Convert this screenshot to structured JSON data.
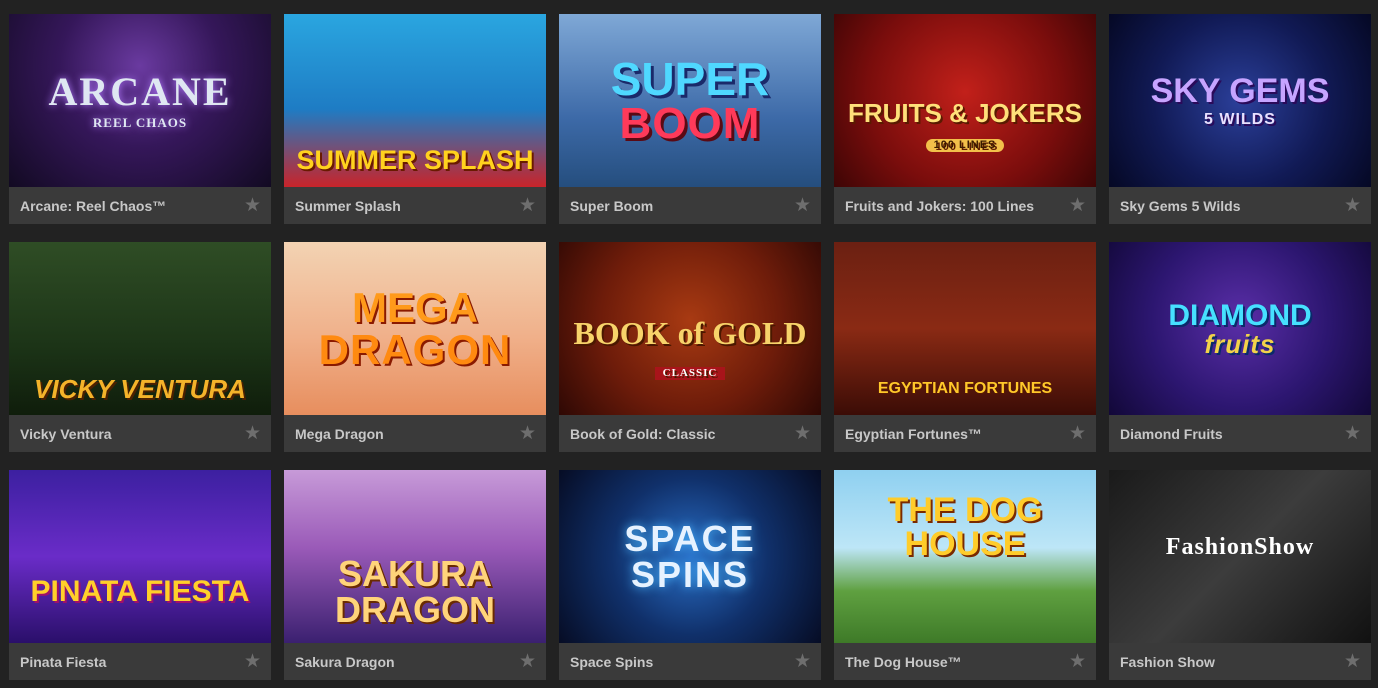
{
  "games": [
    {
      "title": "Arcane: Reel Chaos™",
      "logo": "ARCANE",
      "logo_sub": "REEL CHAOS",
      "art": "a-arcane",
      "logo_class": "l-arcane"
    },
    {
      "title": "Summer Splash",
      "logo": "SUMMER SPLASH",
      "logo_sub": "",
      "art": "a-summer",
      "logo_class": "l-summer"
    },
    {
      "title": "Super Boom",
      "logo": "SUPER",
      "logo_sub": "BOOM",
      "art": "a-super",
      "logo_class": "l-super"
    },
    {
      "title": "Fruits and Jokers: 100 Lines",
      "logo": "FRUITS & JOKERS",
      "logo_sub": "100 LINES",
      "art": "a-fruits",
      "logo_class": "l-fruits"
    },
    {
      "title": "Sky Gems 5 Wilds",
      "logo": "SKY GEMS",
      "logo_sub": "5 WILDS",
      "art": "a-sky",
      "logo_class": "l-sky"
    },
    {
      "title": "Vicky Ventura",
      "logo": "VICKY VENTURA",
      "logo_sub": "",
      "art": "a-vicky",
      "logo_class": "l-vicky"
    },
    {
      "title": "Mega Dragon",
      "logo": "MEGA",
      "logo_sub": "DRAGON",
      "art": "a-mega",
      "logo_class": "l-mega"
    },
    {
      "title": "Book of Gold: Classic",
      "logo": "BOOK of GOLD",
      "logo_sub": "CLASSIC",
      "art": "a-book",
      "logo_class": "l-book"
    },
    {
      "title": "Egyptian Fortunes™",
      "logo": "EGYPTIAN FORTUNES",
      "logo_sub": "",
      "art": "a-egypt",
      "logo_class": "l-egypt"
    },
    {
      "title": "Diamond Fruits",
      "logo": "DIAMOND",
      "logo_sub": "fruits",
      "art": "a-diamond",
      "logo_class": "l-diamond"
    },
    {
      "title": "Pinata Fiesta",
      "logo": "PINATA FIESTA",
      "logo_sub": "",
      "art": "a-pinata",
      "logo_class": "l-pinata"
    },
    {
      "title": "Sakura Dragon",
      "logo": "SAKURA DRAGON",
      "logo_sub": "",
      "art": "a-sakura",
      "logo_class": "l-sakura"
    },
    {
      "title": "Space Spins",
      "logo": "SPACE SPINS",
      "logo_sub": "",
      "art": "a-space",
      "logo_class": "l-space"
    },
    {
      "title": "The Dog House™",
      "logo": "THE DOG HOUSE",
      "logo_sub": "",
      "art": "a-dog",
      "logo_class": "l-dog"
    },
    {
      "title": "Fashion Show",
      "logo": "FashionShow",
      "logo_sub": "",
      "art": "a-fashion",
      "logo_class": "l-fashion"
    }
  ],
  "favorite_icon": "star-icon",
  "favorite_glyph": "★",
  "colors": {
    "page_bg": "#222222",
    "caption_bg": "#3a3a3a",
    "caption_text": "#c8c8c8",
    "star": "#6e6e6e"
  }
}
